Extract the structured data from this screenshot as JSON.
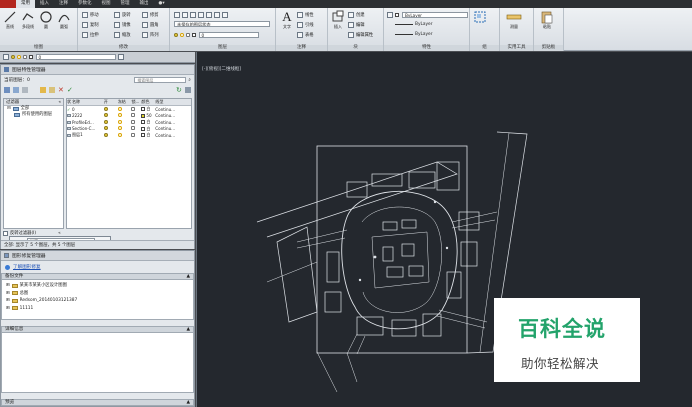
{
  "ribbon": {
    "tabs": [
      "",
      "常用",
      "插入",
      "注释",
      "参数化",
      "视图",
      "管理",
      "输出",
      ""
    ],
    "active_tab_index": 1,
    "draw_panel": {
      "title": "绘图",
      "line": "直线",
      "polyline": "多段线",
      "circle": "圆",
      "arc": "圆弧"
    },
    "modify_panel": {
      "title": "修改",
      "move": "移动",
      "rotate": "旋转",
      "trim": "修剪",
      "copy": "复制",
      "mirror": "镜像",
      "fillet": "圆角",
      "stretch": "拉伸",
      "scale": "缩放",
      "array": "阵列"
    },
    "layers_panel": {
      "title": "图层",
      "unsaved_state": "未保存的图层状态",
      "layer_value": "0"
    },
    "annotation_panel": {
      "title": "注释",
      "text": "文字",
      "linear": "线性",
      "leader": "引线",
      "table": "表格"
    },
    "block_panel": {
      "title": "块",
      "insert": "插入",
      "create": "创建",
      "edit": "编辑",
      "edit_attr": "编辑属性"
    },
    "properties_panel": {
      "title": "特性",
      "color": "ByLayer",
      "linetype": "ByLayer",
      "lineweight": "ByLayer"
    },
    "groups_panel": {
      "title": "组"
    },
    "utilities_panel": {
      "title": "实用工具",
      "measure": "测量"
    },
    "clipboard_panel": {
      "title": "剪贴板",
      "paste": "粘贴"
    }
  },
  "layerbar": {
    "current": "0"
  },
  "layer_manager": {
    "title": "图层特性管理器",
    "current_layer_label": "当前图层：0",
    "search_placeholder": "搜索图层",
    "filter_header": "过滤器",
    "filter_tree": [
      "全部",
      "所有使用的图层"
    ],
    "columns": [
      "状",
      "名称",
      "开",
      "冻结",
      "锁...",
      "颜色",
      "线型"
    ],
    "layers": [
      {
        "name": "0",
        "color_name": "白",
        "color": "#ffffff",
        "linetype": "Continu..."
      },
      {
        "name": "2222",
        "color_name": "50",
        "color": "#e0d62a",
        "linetype": "Continu..."
      },
      {
        "name": "ProfileEd...",
        "color_name": "白",
        "color": "#ffffff",
        "linetype": "Continu..."
      },
      {
        "name": "Section-C...",
        "color_name": "白",
        "color": "#ffffff",
        "linetype": "Continu..."
      },
      {
        "name": "图层1",
        "color_name": "白",
        "color": "#ffffff",
        "linetype": "Continu..."
      }
    ],
    "ucs_value": "世界",
    "invert_filter": "反转过滤器(I)",
    "status": "全部: 显示了 5 个图层，共 5 个图层"
  },
  "recovery_manager": {
    "title": "图形修复管理器",
    "link": "了解图形修复",
    "backup_header": "备份文件",
    "backup_files": [
      "某某市某某小区设计图图",
      "总图",
      "Redsom_20140103121387",
      "11111"
    ],
    "details_header": "详细信息",
    "preview_header": "预览"
  },
  "viewport": {
    "label": "[-][俯视][二维线框]"
  },
  "watermark": {
    "title": "百科全说",
    "subtitle": "助你轻松解决",
    "color": "#23a36b"
  }
}
